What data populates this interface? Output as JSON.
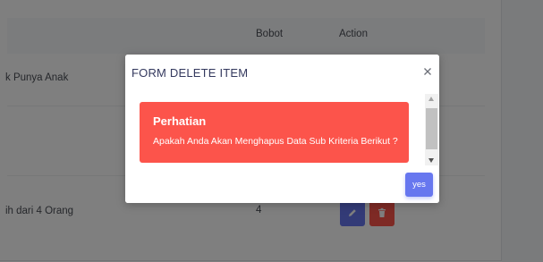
{
  "table": {
    "headers": {
      "bobot": "Bobot",
      "action": "Action"
    },
    "rows": [
      {
        "name": "k Punya Anak",
        "bobot": ""
      },
      {
        "name": "ih dari 4 Orang",
        "bobot": "4"
      }
    ]
  },
  "icons": {
    "edit": "pencil-icon",
    "delete": "trash-icon",
    "close": "close-icon"
  },
  "modal": {
    "title": "FORM DELETE ITEM",
    "close_label": "×",
    "alert": {
      "title": "Perhatian",
      "message": "Apakah Anda Akan Menghapus Data Sub Kriteria Berikut ?"
    },
    "confirm_label": "yes"
  },
  "colors": {
    "primary": "#6777ef",
    "danger": "#fc544b",
    "backdrop": "rgba(0,0,0,0.5)"
  }
}
